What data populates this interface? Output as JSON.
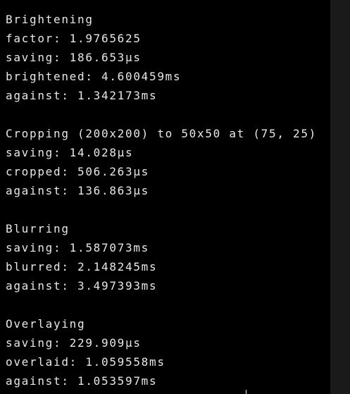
{
  "terminal": {
    "lines": [
      "Brightening",
      "factor: 1.9765625",
      "saving: 186.653µs",
      "brightened: 4.600459ms",
      "against: 1.342173ms",
      "",
      "Cropping (200x200) to 50x50 at (75, 25)",
      "saving: 14.028µs",
      "cropped: 506.263µs",
      "against: 136.863µs",
      "",
      "Blurring",
      "saving: 1.587073ms",
      "blurred: 2.148245ms",
      "against: 3.497393ms",
      "",
      "Overlaying",
      "saving: 229.909µs",
      "overlaid: 1.059558ms",
      "against: 1.053597ms"
    ]
  },
  "colors": {
    "background": "#000000",
    "text": "#e8e8e8",
    "scrollbar_track": "#1a1a1a"
  }
}
